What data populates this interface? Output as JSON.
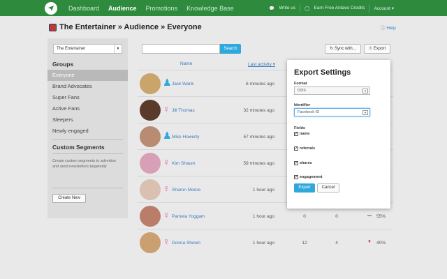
{
  "topnav": {
    "items": [
      "Dashboard",
      "Audience",
      "Promotions",
      "Knowledge Base"
    ],
    "active": "Audience",
    "write_us": "Write us",
    "earn": "Earn Free Antavo Credits",
    "account": "Account ▾"
  },
  "page": {
    "title": "The Entertainer » Audience » Everyone",
    "help": "Help"
  },
  "sidebar": {
    "account_select": "The Entertainer",
    "groups_title": "Groups",
    "groups": [
      "Everyone",
      "Brand Advocates",
      "Super Fans",
      "Active Fans",
      "Sleepers",
      "Newly engaged"
    ],
    "segments_title": "Custom Segments",
    "segments_desc": "Create custom segments to advertise and send newsletters targetedly",
    "create_new": "Create New"
  },
  "toolbar": {
    "search_placeholder": "",
    "search_button": "Search",
    "sync": "Sync with...",
    "export": "Export"
  },
  "table": {
    "col_name": "Name",
    "col_activity": "Last activity ▾",
    "rows": [
      {
        "name": "Jack Wank",
        "gender": "male",
        "activity": "6 minutes ago",
        "a": "",
        "b": "",
        "pct": "",
        "trend": ""
      },
      {
        "name": "Jill Thomas",
        "gender": "female",
        "activity": "32 minutes ago",
        "a": "",
        "b": "",
        "pct": "",
        "trend": ""
      },
      {
        "name": "Mike Howerty",
        "gender": "male",
        "activity": "57 minutes ago",
        "a": "",
        "b": "",
        "pct": "",
        "trend": ""
      },
      {
        "name": "Kim Shaum",
        "gender": "female",
        "activity": "59 minutes ago",
        "a": "",
        "b": "",
        "pct": "",
        "trend": ""
      },
      {
        "name": "Sharon Moore",
        "gender": "female",
        "activity": "1 hour ago",
        "a": "",
        "b": "",
        "pct": "",
        "trend": ""
      },
      {
        "name": "Pamela Yoggam",
        "gender": "female",
        "activity": "1 hour ago",
        "a": "0",
        "b": "0",
        "pct": "55%",
        "trend": "flat"
      },
      {
        "name": "Donna Shown",
        "gender": "female",
        "activity": "1 hour ago",
        "a": "12",
        "b": "4",
        "pct": "40%",
        "trend": "down"
      }
    ]
  },
  "export_modal": {
    "title": "Export Settings",
    "format_label": "Format",
    "format_value": "ODS",
    "identifier_label": "Identifier",
    "identifier_value": "Facebook ID",
    "fields_label": "Fields",
    "fields": [
      "name",
      "referrals",
      "shares",
      "engagement"
    ],
    "export_button": "Export",
    "cancel_button": "Cancel"
  },
  "colors": {
    "nav_green": "#2e8b3e",
    "accent_blue": "#2fa8dd",
    "male": "#2fa8dd",
    "female": "#e35ca8",
    "trend_down": "#cc2222"
  },
  "icons": [
    "logo-icon",
    "speech-icon",
    "shield-icon",
    "chevron-down-icon",
    "sync-icon",
    "export-icon",
    "help-icon",
    "male-icon",
    "female-icon",
    "checkbox-checked-icon"
  ]
}
